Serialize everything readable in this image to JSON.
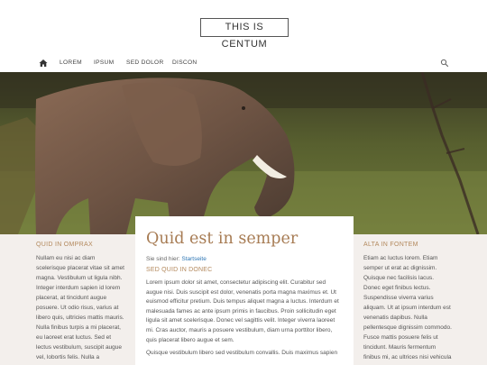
{
  "site": {
    "logo": "THIS IS CENTUM"
  },
  "nav": {
    "items": [
      "LOREM",
      "IPSUM",
      "SED DOLOR",
      "DISCON"
    ]
  },
  "hero": {
    "alt": "elephant"
  },
  "left": {
    "heading": "QUID IN OMPRAX",
    "text": "Nullam eu nisi ac diam scelerisque placerat vitae sit amet magna. Vestibulum ut ligula nibh. Integer interdum sapien id lorem placerat, at tincidunt augue posuere. Ut odio risus, varius at libero quis, ultricies mattis mauris. Nulla finibus turpis a mi placerat, eu laoreet erat luctus. Sed et lectus vestibulum, suscipit augue vel, lobortis felis. Nulla a"
  },
  "main": {
    "title": "Quid est in semper",
    "breadcrumb_prefix": "Sie sind hier: ",
    "breadcrumb_link": "Startseite",
    "subheading": "SED QUID IN DONEC",
    "paragraph1": "Lorem ipsum dolor sit amet, consectetur adipiscing elit. Curabitur sed augue nisi. Duis suscipit est dolor, venenatis porta magna maximus et. Ut euismod efficitur pretium. Duis tempus aliquet magna a luctus. Interdum et malesuada fames ac ante ipsum primis in faucibus. Proin sollicitudin eget ligula sit amet scelerisque. Donec vel sagittis velit. Integer viverra laoreet mi. Cras auctor, mauris a posuere vestibulum, diam urna porttitor libero, quis placerat libero augue et sem.",
    "paragraph2": "Quisque vestibulum libero sed vestibulum convallis. Duis maximus sapien"
  },
  "right": {
    "heading": "ALTA IN FONTEM",
    "text": "Etiam ac luctus lorem. Etiam semper ut erat ac dignissim. Quisque nec facilisis lacus. Donec eget finibus lectus. Suspendisse viverra varius aliquam. Ut at ipsum interdum est venenatis dapibus. Nulla pellentesque dignissim commodo. Fusce mattis posuere felis ut tincidunt. Mauris fermentum finibus mi, ac ultrices nisi vehicula nec."
  },
  "colors": {
    "accent": "#b3895d",
    "title": "#a77c54",
    "link": "#2f77b5",
    "band": "#f3efec"
  }
}
